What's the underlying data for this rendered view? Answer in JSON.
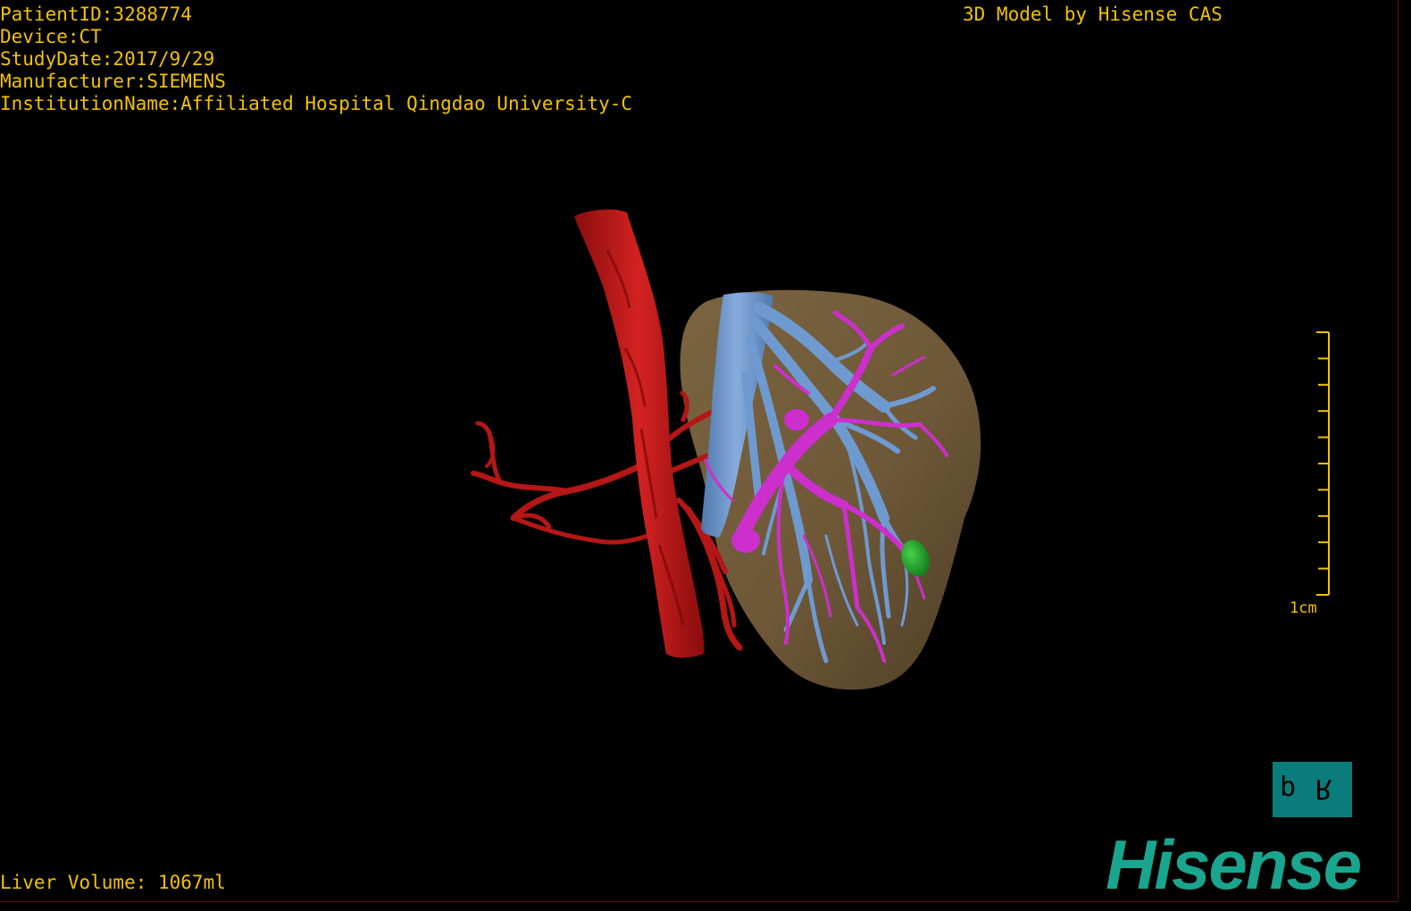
{
  "overlay": {
    "patient_id": "PatientID:3288774",
    "device": "Device:CT",
    "study_date": "StudyDate:2017/9/29",
    "manufacturer": "Manufacturer:SIEMENS",
    "institution": "InstitutionName:Affiliated Hospital Qingdao University-C",
    "model_credit": "3D Model by Hisense CAS",
    "liver_volume": "Liver Volume: 1067ml"
  },
  "scale_bar": {
    "label": "1cm",
    "ticks": 11
  },
  "orientation_marker": {
    "left": "d",
    "right": "R"
  },
  "logo": {
    "text": "Hisense"
  },
  "colors": {
    "overlay_text": "#f2c200",
    "liver": "#6e5838",
    "artery": "#c01818",
    "vein": "#6f9ad0",
    "portal_vein": "#cc2fcc",
    "lesion": "#1fae2a",
    "logo": "#1aa58f",
    "orientation_bg": "#0b7c7c"
  }
}
